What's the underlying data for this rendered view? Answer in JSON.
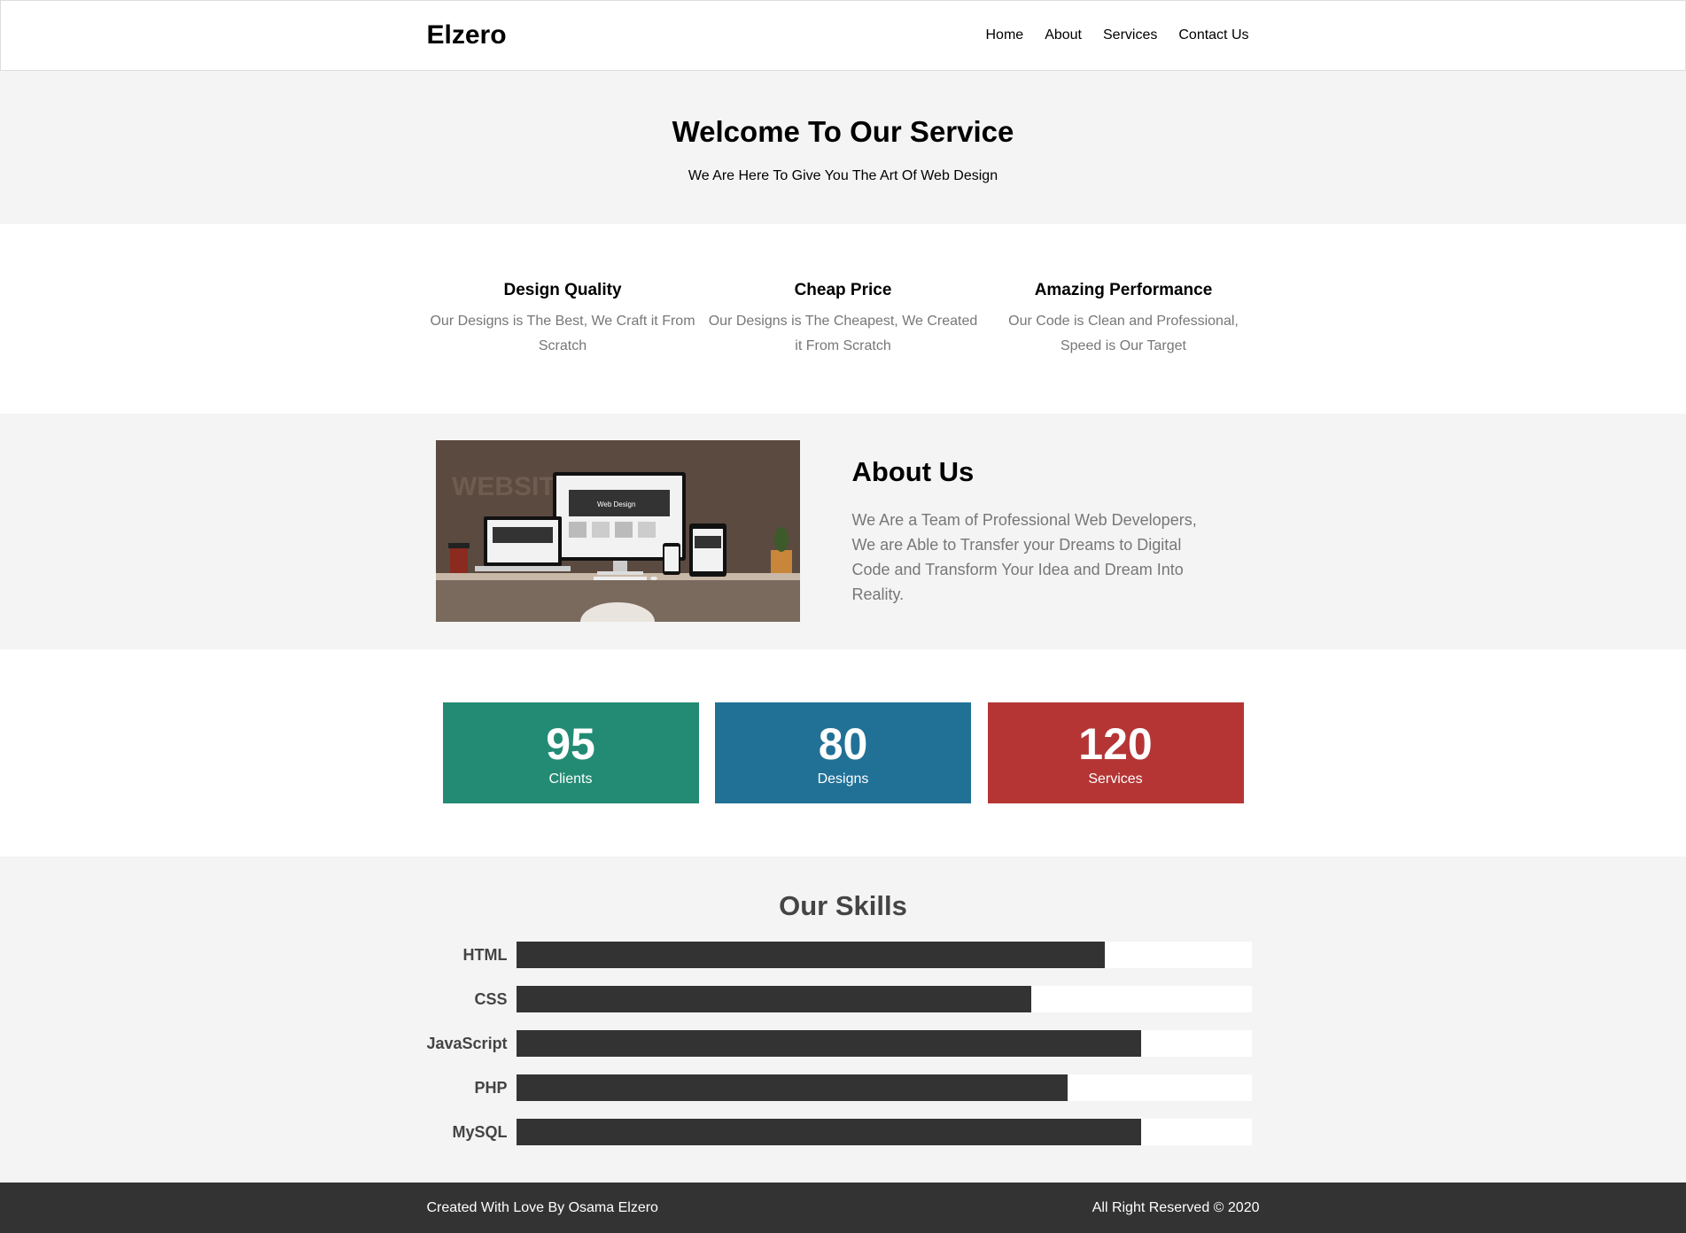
{
  "header": {
    "logo": "Elzero",
    "nav": [
      "Home",
      "About",
      "Services",
      "Contact Us"
    ]
  },
  "landing": {
    "title": "Welcome To Our Service",
    "subtitle": "We Are Here To Give You The Art Of Web Design"
  },
  "features": [
    {
      "title": "Design Quality",
      "text": "Our Designs is The Best, We Craft it From Scratch"
    },
    {
      "title": "Cheap Price",
      "text": "Our Designs is The Cheapest, We Created it From Scratch"
    },
    {
      "title": "Amazing Performance",
      "text": "Our Code is Clean and Professional, Speed is Our Target"
    }
  ],
  "about": {
    "title": "About Us",
    "text": "We Are a Team of Professional Web Developers, We are Able to Transfer your Dreams to Digital Code and Transform Your Idea and Dream Into Reality.",
    "image_texts": [
      "WEBSITE",
      "Web Design"
    ]
  },
  "stats": [
    {
      "num": "95",
      "label": "Clients",
      "color": "#238b74"
    },
    {
      "num": "80",
      "label": "Designs",
      "color": "#217197"
    },
    {
      "num": "120",
      "label": "Services",
      "color": "#b53535"
    }
  ],
  "skills": {
    "title": "Our Skills",
    "items": [
      {
        "name": "HTML",
        "progress": 80
      },
      {
        "name": "CSS",
        "progress": 70
      },
      {
        "name": "JavaScript",
        "progress": 85
      },
      {
        "name": "PHP",
        "progress": 75
      },
      {
        "name": "MySQL",
        "progress": 85
      }
    ]
  },
  "footer": {
    "left": "Created With Love By Osama Elzero",
    "right": "All Right Reserved © 2020"
  }
}
